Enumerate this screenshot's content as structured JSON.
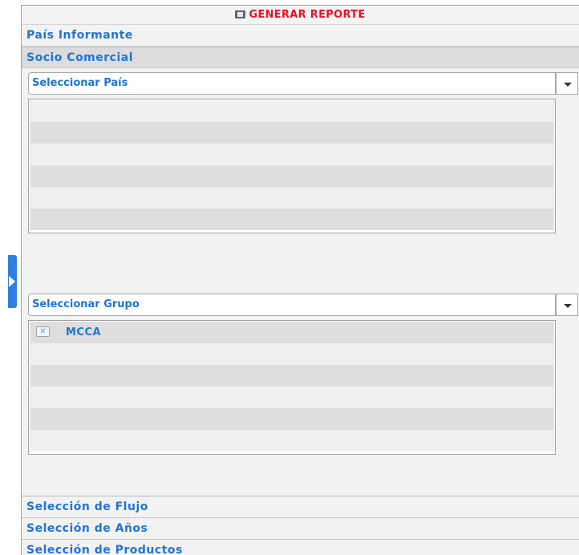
{
  "report": {
    "button_label": "GENERAR REPORTE",
    "icon": "report-icon"
  },
  "sections": {
    "pais_informante": "País Informante",
    "socio_comercial": "Socio Comercial",
    "seleccion_flujo": "Selección de Flujo",
    "seleccion_anos": "Selección de Años",
    "seleccion_productos": "Selección de Productos"
  },
  "socio": {
    "pais_combo": {
      "value": "Seleccionar País",
      "icon": "chevron-down-icon"
    },
    "grupo_combo": {
      "value": "Seleccionar Grupo",
      "icon": "chevron-down-icon"
    },
    "selected_groups": [
      {
        "label": "MCCA",
        "remove_icon": "close-icon"
      }
    ]
  },
  "sidebar_toggle": {
    "icon": "chevron-right-icon"
  },
  "colors": {
    "accent_blue": "#1f74d6",
    "report_red": "#e8112d",
    "toggle_blue": "#2f7fe0"
  }
}
